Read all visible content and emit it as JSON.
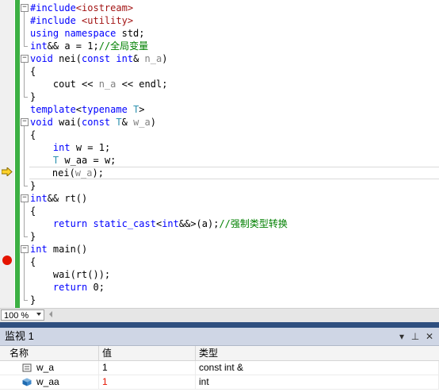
{
  "editor": {
    "lines": [
      [
        {
          "t": "#include",
          "c": "kw"
        },
        {
          "t": "<iostream>",
          "c": "inc"
        }
      ],
      [
        {
          "t": "#include",
          "c": "kw"
        },
        {
          "t": " ",
          "c": ""
        },
        {
          "t": "<utility>",
          "c": "inc"
        }
      ],
      [
        {
          "t": "using namespace",
          "c": "kw"
        },
        {
          "t": " std;",
          "c": ""
        }
      ],
      [
        {
          "t": "int",
          "c": "kw"
        },
        {
          "t": "&& a = 1;",
          "c": ""
        },
        {
          "t": "//全局变量",
          "c": "cmt"
        }
      ],
      [
        {
          "t": "void",
          "c": "kw"
        },
        {
          "t": " nei(",
          "c": ""
        },
        {
          "t": "const int",
          "c": "kw"
        },
        {
          "t": "& ",
          "c": ""
        },
        {
          "t": "n_a",
          "c": "param"
        },
        {
          "t": ")",
          "c": ""
        }
      ],
      [
        {
          "t": "{",
          "c": ""
        }
      ],
      [
        {
          "t": "    cout << ",
          "c": ""
        },
        {
          "t": "n_a",
          "c": "param"
        },
        {
          "t": " << endl;",
          "c": ""
        }
      ],
      [
        {
          "t": "}",
          "c": ""
        }
      ],
      [
        {
          "t": "template",
          "c": "kw"
        },
        {
          "t": "<",
          "c": ""
        },
        {
          "t": "typename",
          "c": "kw"
        },
        {
          "t": " ",
          "c": ""
        },
        {
          "t": "T",
          "c": "type"
        },
        {
          "t": ">",
          "c": ""
        }
      ],
      [
        {
          "t": "void",
          "c": "kw"
        },
        {
          "t": " wai(",
          "c": ""
        },
        {
          "t": "const",
          "c": "kw"
        },
        {
          "t": " ",
          "c": ""
        },
        {
          "t": "T",
          "c": "type"
        },
        {
          "t": "& ",
          "c": ""
        },
        {
          "t": "w_a",
          "c": "param"
        },
        {
          "t": ")",
          "c": ""
        }
      ],
      [
        {
          "t": "{",
          "c": ""
        }
      ],
      [
        {
          "t": "    ",
          "c": ""
        },
        {
          "t": "int",
          "c": "kw"
        },
        {
          "t": " w = 1;",
          "c": ""
        }
      ],
      [
        {
          "t": "    ",
          "c": ""
        },
        {
          "t": "T",
          "c": "type"
        },
        {
          "t": " w_aa = w;",
          "c": ""
        }
      ],
      [
        {
          "t": "    nei(",
          "c": ""
        },
        {
          "t": "w_a",
          "c": "param"
        },
        {
          "t": ");",
          "c": ""
        }
      ],
      [
        {
          "t": "}",
          "c": ""
        }
      ],
      [
        {
          "t": "int",
          "c": "kw"
        },
        {
          "t": "&& rt()",
          "c": ""
        }
      ],
      [
        {
          "t": "{",
          "c": ""
        }
      ],
      [
        {
          "t": "    ",
          "c": ""
        },
        {
          "t": "return static_cast",
          "c": "kw"
        },
        {
          "t": "<",
          "c": ""
        },
        {
          "t": "int",
          "c": "kw"
        },
        {
          "t": "&&>(a);",
          "c": ""
        },
        {
          "t": "//强制类型转换",
          "c": "cmt"
        }
      ],
      [
        {
          "t": "}",
          "c": ""
        }
      ],
      [
        {
          "t": "int",
          "c": "kw"
        },
        {
          "t": " main()",
          "c": ""
        }
      ],
      [
        {
          "t": "{",
          "c": ""
        }
      ],
      [
        {
          "t": "    wai(rt());",
          "c": ""
        }
      ],
      [
        {
          "t": "    ",
          "c": ""
        },
        {
          "t": "return",
          "c": "kw"
        },
        {
          "t": " 0;",
          "c": ""
        }
      ],
      [
        {
          "t": "}",
          "c": ""
        }
      ]
    ],
    "current_line_index": 13,
    "breakpoint_line_index": 20,
    "fold_minus": "−"
  },
  "status": {
    "zoom": "100 %"
  },
  "watch": {
    "title": "监视 1",
    "buttons": {
      "dropdown": "▾",
      "pin": "⊥",
      "close": "✕"
    },
    "columns": {
      "name": "名称",
      "value": "值",
      "type": "类型"
    },
    "rows": [
      {
        "name": "w_a",
        "value": "1",
        "type": "const int &",
        "changed": false,
        "icon": "variable-field-icon"
      },
      {
        "name": "w_aa",
        "value": "1",
        "type": "int",
        "changed": true,
        "icon": "variable-object-icon"
      }
    ]
  },
  "colors": {
    "keyword": "#0000ff",
    "include": "#a31515",
    "comment": "#008000",
    "param": "#808080",
    "type": "#2b91af",
    "change_bar": "#3cb043",
    "breakpoint": "#e51400",
    "panel_header": "#cfd6e5"
  }
}
